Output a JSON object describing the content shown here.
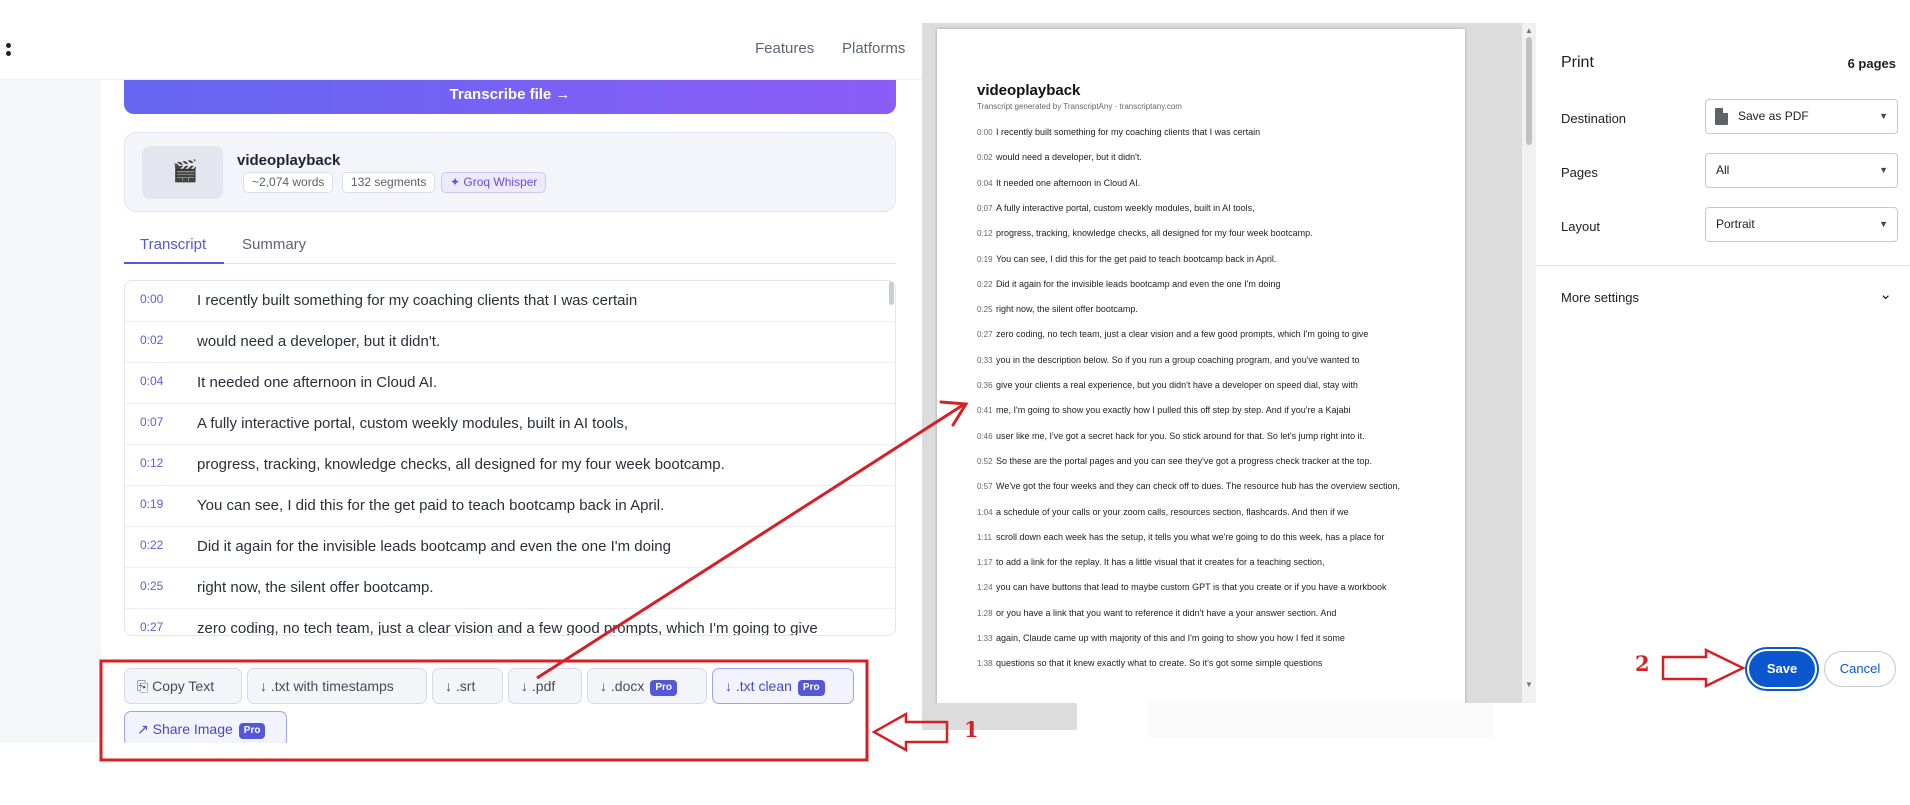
{
  "nav": {
    "features": "Features",
    "platforms": "Platforms"
  },
  "transcribe_button": "Transcribe file →",
  "file_card": {
    "thumb_icon": "clapperboard-icon",
    "name": "videoplayback",
    "words": "~2,074 words",
    "segments": "132 segments",
    "engine": "✦ Groq Whisper"
  },
  "tabs": {
    "transcript": "Transcript",
    "summary": "Summary"
  },
  "transcript": [
    {
      "time": "0:00",
      "text": "I recently built something for my coaching clients that I was certain"
    },
    {
      "time": "0:02",
      "text": "would need a developer, but it didn't."
    },
    {
      "time": "0:04",
      "text": "It needed one afternoon in Cloud AI."
    },
    {
      "time": "0:07",
      "text": "A fully interactive portal, custom weekly modules, built in AI tools,"
    },
    {
      "time": "0:12",
      "text": "progress, tracking, knowledge checks, all designed for my four week bootcamp."
    },
    {
      "time": "0:19",
      "text": "You can see, I did this for the get paid to teach bootcamp back in April."
    },
    {
      "time": "0:22",
      "text": "Did it again for the invisible leads bootcamp and even the one I'm doing"
    },
    {
      "time": "0:25",
      "text": "right now, the silent offer bootcamp."
    },
    {
      "time": "0:27",
      "text": "zero coding, no tech team, just a clear vision and a few good prompts, which I'm going to give"
    }
  ],
  "export": {
    "copy": "Copy Text",
    "txt_ts": "↓ .txt with timestamps",
    "srt": "↓ .srt",
    "pdf": "↓ .pdf",
    "docx": "↓ .docx",
    "txt_clean": "↓ .txt clean",
    "share": "↗ Share Image",
    "pro": "Pro"
  },
  "preview": {
    "title": "videoplayback",
    "subtitle": "Transcript generated by TranscriptAny · transcriptany.com",
    "rows": [
      {
        "time": "0:00",
        "text": "I recently built something for my coaching clients that I was certain"
      },
      {
        "time": "0:02",
        "text": "would need a developer, but it didn't."
      },
      {
        "time": "0:04",
        "text": "It needed one afternoon in Cloud AI."
      },
      {
        "time": "0:07",
        "text": "A fully interactive portal, custom weekly modules, built in AI tools,"
      },
      {
        "time": "0:12",
        "text": "progress, tracking, knowledge checks, all designed for my four week bootcamp."
      },
      {
        "time": "0:19",
        "text": "You can see, I did this for the get paid to teach bootcamp back in April."
      },
      {
        "time": "0:22",
        "text": "Did it again for the invisible leads bootcamp and even the one I'm doing"
      },
      {
        "time": "0:25",
        "text": "right now, the silent offer bootcamp."
      },
      {
        "time": "0:27",
        "text": "zero coding, no tech team, just a clear vision and a few good prompts, which I'm going to give"
      },
      {
        "time": "0:33",
        "text": "you in the description below. So if you run a group coaching program, and you've wanted to"
      },
      {
        "time": "0:36",
        "text": "give your clients a real experience, but you didn't have a developer on speed dial, stay with"
      },
      {
        "time": "0:41",
        "text": "me, I'm going to show you exactly how I pulled this off step by step. And if you're a Kajabi"
      },
      {
        "time": "0:46",
        "text": "user like me, I've got a secret hack for you. So stick around for that. So let's jump right into it."
      },
      {
        "time": "0:52",
        "text": "So these are the portal pages and you can see they've got a progress check tracker at the top."
      },
      {
        "time": "0:57",
        "text": "We've got the four weeks and they can check off to dues. The resource hub has the overview section,"
      },
      {
        "time": "1:04",
        "text": "a schedule of your calls or your zoom calls, resources section, flashcards. And then if we"
      },
      {
        "time": "1:11",
        "text": "scroll down each week has the setup, it tells you what we're going to do this week, has a place for"
      },
      {
        "time": "1:17",
        "text": "to add a link for the replay. It has a little visual that it creates for a teaching section,"
      },
      {
        "time": "1:24",
        "text": "you can have buttons that lead to maybe custom GPT is that you create or if you have a workbook"
      },
      {
        "time": "1:28",
        "text": "or you have a link that you want to reference it didn't have a your answer section. And"
      },
      {
        "time": "1:33",
        "text": "again, Claude came up with majority of this and I'm going to show you how I fed it some"
      },
      {
        "time": "1:38",
        "text": "questions so that it knew exactly what to create. So it's got some simple questions"
      }
    ]
  },
  "print": {
    "title": "Print",
    "pages_count": "6 pages",
    "destination_label": "Destination",
    "destination_value": "Save as PDF",
    "pages_label": "Pages",
    "pages_value": "All",
    "layout_label": "Layout",
    "layout_value": "Portrait",
    "more_settings": "More settings",
    "save": "Save",
    "cancel": "Cancel"
  },
  "annotations": {
    "step1": "1",
    "step2": "2",
    "color": "#d42027"
  },
  "colors": {
    "accent": "#5458d6",
    "print_blue": "#0b57d0",
    "annotation_red": "#d42027"
  }
}
